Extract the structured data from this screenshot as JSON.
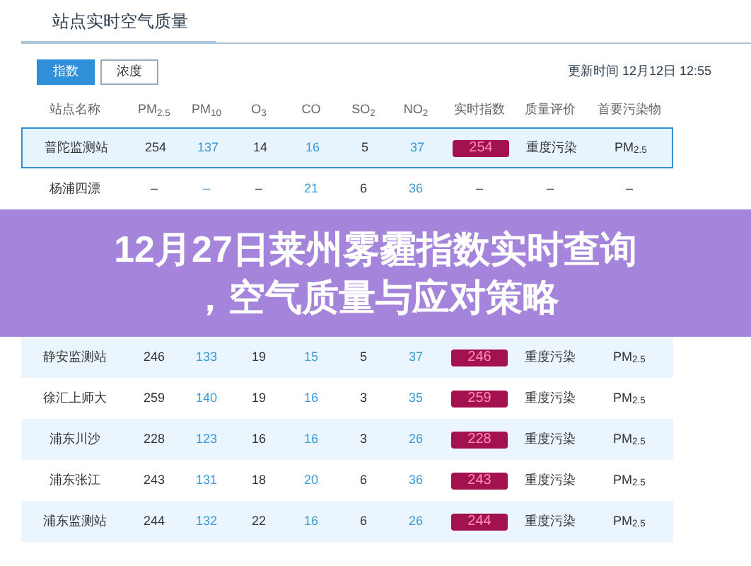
{
  "page_title": "站点实时空气质量",
  "tabs": [
    {
      "label": "指数",
      "selected": true
    },
    {
      "label": "浓度",
      "selected": false
    }
  ],
  "update_time": "更新时间 12月12日 12:55",
  "columns": [
    {
      "label": "站点名称",
      "kind": "text"
    },
    {
      "label": "PM$_{2.5}$",
      "kind": "text"
    },
    {
      "label": "PM$_{10}$",
      "kind": "link"
    },
    {
      "label": "O$_{3}$",
      "kind": "text"
    },
    {
      "label": "CO",
      "kind": "link"
    },
    {
      "label": "SO$_{2}$",
      "kind": "text"
    },
    {
      "label": "NO$_{2}$",
      "kind": "link"
    },
    {
      "label": "实时指数",
      "kind": "badge"
    },
    {
      "label": "质量评价",
      "kind": "text"
    },
    {
      "label": "首要污染物",
      "kind": "text"
    }
  ],
  "rows": [
    {
      "selected": true,
      "cells": [
        "普陀监测站",
        "254",
        "137",
        "14",
        "16",
        "5",
        "37",
        "254",
        "重度污染",
        "PM$_{2.5}$"
      ]
    },
    {
      "selected": false,
      "cells": [
        "杨浦四漂",
        "–",
        "–",
        "–",
        "21",
        "6",
        "36",
        "–",
        "–",
        "–"
      ]
    },
    {
      "selected": false,
      "cells": [
        "静安监测站",
        "246",
        "133",
        "19",
        "15",
        "5",
        "37",
        "246",
        "重度污染",
        "PM$_{2.5}$"
      ]
    },
    {
      "selected": false,
      "cells": [
        "徐汇上师大",
        "259",
        "140",
        "19",
        "16",
        "3",
        "35",
        "259",
        "重度污染",
        "PM$_{2.5}$"
      ]
    },
    {
      "selected": false,
      "cells": [
        "浦东川沙",
        "228",
        "123",
        "16",
        "16",
        "3",
        "26",
        "228",
        "重度污染",
        "PM$_{2.5}$"
      ]
    },
    {
      "selected": false,
      "cells": [
        "浦东张江",
        "243",
        "131",
        "18",
        "20",
        "6",
        "36",
        "243",
        "重度污染",
        "PM$_{2.5}$"
      ]
    },
    {
      "selected": false,
      "cells": [
        "浦东监测站",
        "244",
        "132",
        "22",
        "16",
        "6",
        "26",
        "244",
        "重度污染",
        "PM$_{2.5}$"
      ]
    }
  ],
  "banner": {
    "line_1": "12月27日莱州雾霾指数实时查询",
    "line_2": "，空气质量与应对策略"
  }
}
